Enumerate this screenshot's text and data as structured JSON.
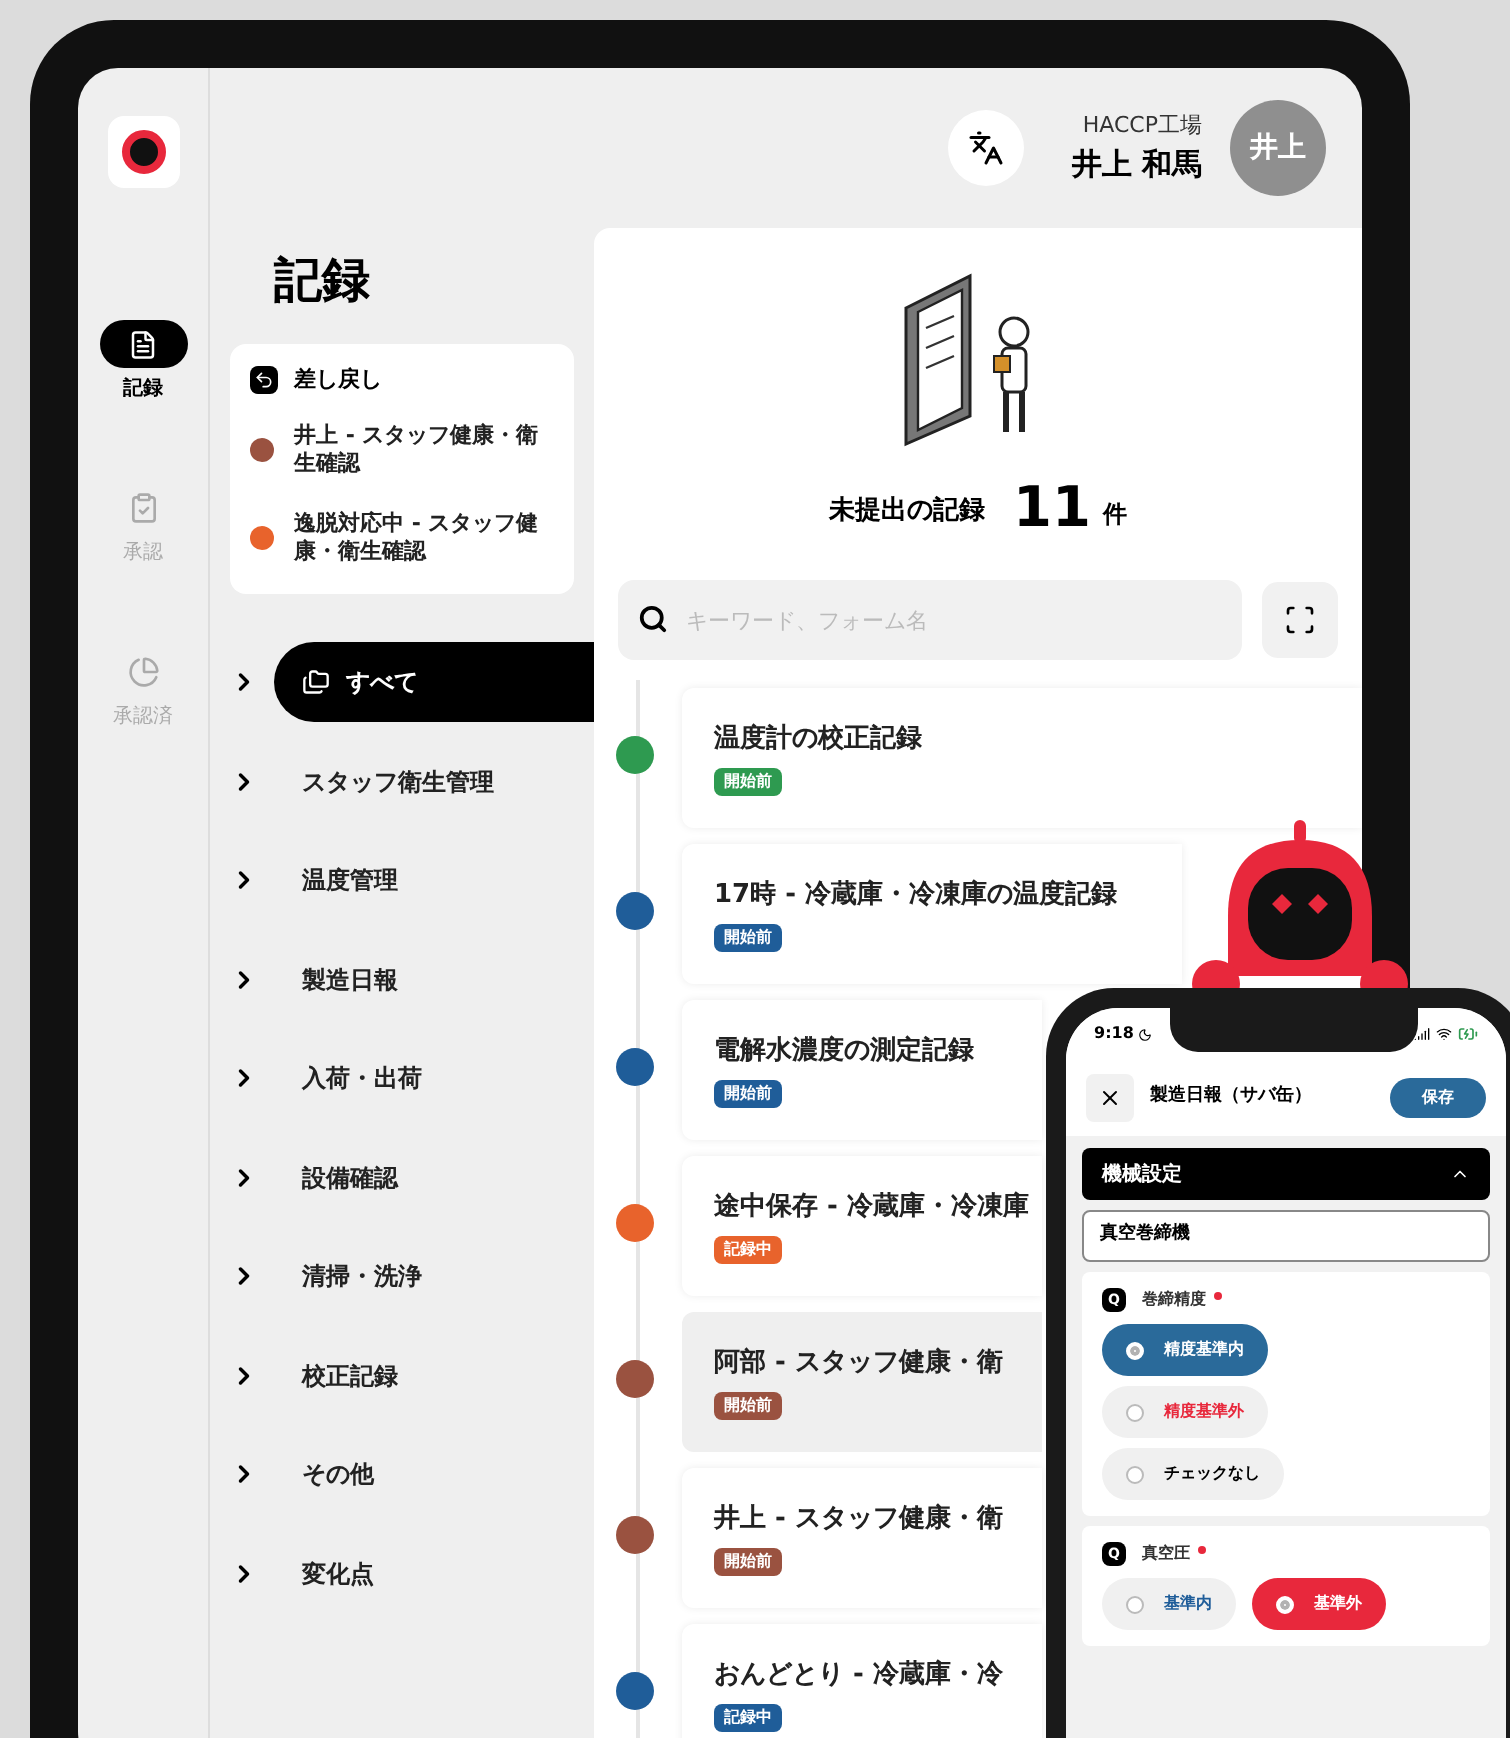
{
  "nav_rail": [
    {
      "label": "記録",
      "kind": "records",
      "selected": true
    },
    {
      "label": "承認",
      "kind": "approve",
      "selected": false
    },
    {
      "label": "承認済",
      "kind": "approved",
      "selected": false
    }
  ],
  "header": {
    "factory": "HACCP工場",
    "user_name": "井上 和馬",
    "avatar": "井上"
  },
  "sidebar": {
    "title": "記録",
    "returned": {
      "title": "差し戻し",
      "items": [
        {
          "label": "井上 - スタッフ健康・衛生確認",
          "color": "#9a5240"
        },
        {
          "label": "逸脱対応中 - スタッフ健康・衛生確認",
          "color": "#e8632c"
        }
      ]
    },
    "categories": [
      {
        "label": "すべて",
        "selected": true
      },
      {
        "label": "スタッフ衛生管理",
        "selected": false
      },
      {
        "label": "温度管理",
        "selected": false
      },
      {
        "label": "製造日報",
        "selected": false
      },
      {
        "label": "入荷・出荷",
        "selected": false
      },
      {
        "label": "設備確認",
        "selected": false
      },
      {
        "label": "清掃・洗浄",
        "selected": false
      },
      {
        "label": "校正記録",
        "selected": false
      },
      {
        "label": "その他",
        "selected": false
      },
      {
        "label": "変化点",
        "selected": false
      }
    ]
  },
  "summary": {
    "label": "未提出の記録",
    "count": "11",
    "unit": "件"
  },
  "search": {
    "placeholder": "キーワード、フォーム名"
  },
  "records": [
    {
      "title": "温度計の校正記録",
      "status": "開始前",
      "color": "#2e9a50",
      "selected": false
    },
    {
      "title": "17時 - 冷蔵庫・冷凍庫の温度記録",
      "status": "開始前",
      "color": "#1f5d99",
      "selected": false
    },
    {
      "title": "電解水濃度の測定記録",
      "status": "開始前",
      "color": "#1f5d99",
      "selected": false
    },
    {
      "title": "途中保存 - 冷蔵庫・冷凍庫",
      "status": "記録中",
      "color": "#e8632c",
      "selected": false
    },
    {
      "title": "阿部 - スタッフ健康・衛",
      "status": "開始前",
      "color": "#9a5240",
      "selected": true
    },
    {
      "title": "井上 - スタッフ健康・衛",
      "status": "開始前",
      "color": "#9a5240",
      "selected": false
    },
    {
      "title": "おんどとり - 冷蔵庫・冷",
      "status": "記録中",
      "color": "#1f5d99",
      "selected": false
    }
  ],
  "phone": {
    "time": "9:18",
    "title": "製造日報（サバ缶）",
    "save": "保存",
    "section": {
      "label": "機械設定",
      "expanded": true
    },
    "field_value": "真空巻締機",
    "questions": [
      {
        "badge": "Q",
        "label": "巻締精度",
        "required": true,
        "kind": "column",
        "options": [
          {
            "label": "精度基準内",
            "kind": "ok",
            "selected": true
          },
          {
            "label": "精度基準外",
            "kind": "ng",
            "selected": false
          },
          {
            "label": "チェックなし",
            "kind": "none",
            "selected": false
          }
        ]
      },
      {
        "badge": "Q",
        "label": "真空圧",
        "required": true,
        "kind": "row",
        "options": [
          {
            "label": "基準内",
            "kind": "ok",
            "selected": false
          },
          {
            "label": "基準外",
            "kind": "ng",
            "selected": true
          }
        ]
      }
    ]
  }
}
